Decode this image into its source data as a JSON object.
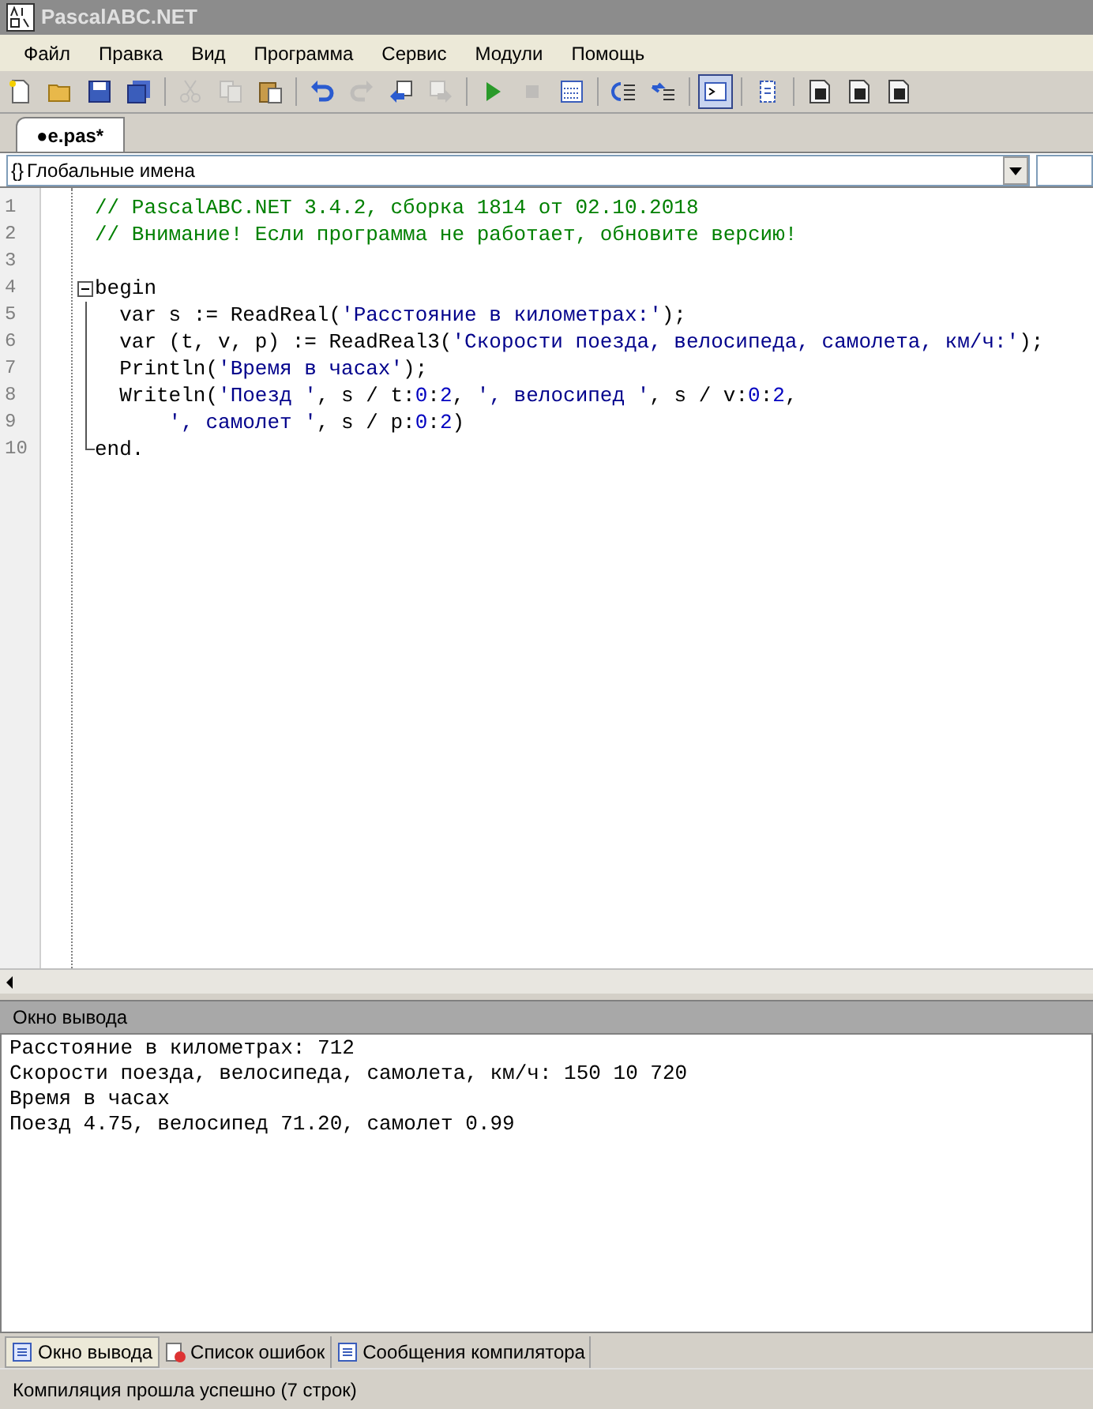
{
  "window": {
    "title": "PascalABC.NET"
  },
  "menu": [
    "Файл",
    "Правка",
    "Вид",
    "Программа",
    "Сервис",
    "Модули",
    "Помощь"
  ],
  "toolbar": [
    {
      "kind": "new",
      "disabled": false,
      "selected": false
    },
    {
      "kind": "open",
      "disabled": false,
      "selected": false
    },
    {
      "kind": "save",
      "disabled": false,
      "selected": false
    },
    {
      "kind": "saveall",
      "disabled": false,
      "selected": false
    },
    {
      "kind": "sep"
    },
    {
      "kind": "cut",
      "disabled": true,
      "selected": false
    },
    {
      "kind": "copy",
      "disabled": true,
      "selected": false
    },
    {
      "kind": "paste",
      "disabled": false,
      "selected": false
    },
    {
      "kind": "sep"
    },
    {
      "kind": "undo",
      "disabled": false,
      "selected": false
    },
    {
      "kind": "redo",
      "disabled": true,
      "selected": false
    },
    {
      "kind": "back",
      "disabled": false,
      "selected": false
    },
    {
      "kind": "forward",
      "disabled": true,
      "selected": false
    },
    {
      "kind": "sep"
    },
    {
      "kind": "run",
      "disabled": false,
      "selected": false
    },
    {
      "kind": "stop",
      "disabled": true,
      "selected": false
    },
    {
      "kind": "compile",
      "disabled": false,
      "selected": false
    },
    {
      "kind": "sep"
    },
    {
      "kind": "stepin",
      "disabled": false,
      "selected": false
    },
    {
      "kind": "stepover",
      "disabled": false,
      "selected": false
    },
    {
      "kind": "sep"
    },
    {
      "kind": "console",
      "disabled": false,
      "selected": true
    },
    {
      "kind": "sep"
    },
    {
      "kind": "format",
      "disabled": false,
      "selected": false
    },
    {
      "kind": "sep"
    },
    {
      "kind": "doc",
      "disabled": false,
      "selected": false
    },
    {
      "kind": "doc",
      "disabled": false,
      "selected": false
    },
    {
      "kind": "doc",
      "disabled": false,
      "selected": false
    }
  ],
  "doc_tabs": [
    {
      "label": "●e.pas*",
      "selected": true
    }
  ],
  "scope_combo": {
    "icon": "{}",
    "value": "Глобальные имена"
  },
  "editor": {
    "lines": [
      {
        "number": "1",
        "tokens": [
          {
            "kind": "comment",
            "text": "// PascalABC.NET 3.4.2, сборка 1814 от 02.10.2018"
          }
        ]
      },
      {
        "number": "2",
        "tokens": [
          {
            "kind": "comment",
            "text": "// Внимание! Если программа не работает, обновите версию!"
          }
        ]
      },
      {
        "number": "3"
      },
      {
        "number": "4",
        "kind": "fold_start",
        "tokens": [
          {
            "kind": "plain",
            "text": "begin"
          }
        ]
      },
      {
        "number": "5",
        "kind": "fold_inner",
        "tokens": [
          {
            "kind": "plain",
            "text": "  var s := ReadReal("
          },
          {
            "kind": "string",
            "text": "'Расстояние в километрах:'"
          },
          {
            "kind": "plain",
            "text": ");"
          }
        ]
      },
      {
        "number": "6",
        "kind": "fold_inner",
        "tokens": [
          {
            "kind": "plain",
            "text": "  var (t, v, p) := ReadReal3("
          },
          {
            "kind": "string",
            "text": "'Скорости поезда, велосипеда, самолета, км/ч:'"
          },
          {
            "kind": "plain",
            "text": ");"
          }
        ]
      },
      {
        "number": "7",
        "kind": "fold_inner",
        "tokens": [
          {
            "kind": "plain",
            "text": "  Println("
          },
          {
            "kind": "string",
            "text": "'Время в часах'"
          },
          {
            "kind": "plain",
            "text": ");"
          }
        ]
      },
      {
        "number": "8",
        "kind": "fold_inner",
        "tokens": [
          {
            "kind": "plain",
            "text": "  Writeln("
          },
          {
            "kind": "string",
            "text": "'Поезд '"
          },
          {
            "kind": "plain",
            "text": ", s / t:"
          },
          {
            "kind": "number",
            "text": "0"
          },
          {
            "kind": "plain",
            "text": ":"
          },
          {
            "kind": "number",
            "text": "2"
          },
          {
            "kind": "plain",
            "text": ", "
          },
          {
            "kind": "string",
            "text": "', велосипед '"
          },
          {
            "kind": "plain",
            "text": ", s / v:"
          },
          {
            "kind": "number",
            "text": "0"
          },
          {
            "kind": "plain",
            "text": ":"
          },
          {
            "kind": "number",
            "text": "2"
          },
          {
            "kind": "plain",
            "text": ","
          }
        ]
      },
      {
        "number": "9",
        "kind": "fold_inner",
        "tokens": [
          {
            "kind": "string",
            "text": "      ', самолет '"
          },
          {
            "kind": "plain",
            "text": ", s / p:"
          },
          {
            "kind": "number",
            "text": "0"
          },
          {
            "kind": "plain",
            "text": ":"
          },
          {
            "kind": "number",
            "text": "2"
          },
          {
            "kind": "plain",
            "text": ")"
          }
        ]
      },
      {
        "number": "10",
        "kind": "fold_end",
        "tokens": [
          {
            "kind": "plain",
            "text": "end."
          }
        ]
      }
    ]
  },
  "output": {
    "title": "Окно вывода",
    "lines": [
      "Расстояние в километрах: 712",
      "Скорости поезда, велосипеда, самолета, км/ч: 150 10 720",
      "Время в часах",
      "Поезд 4.75, велосипед 71.20, самолет 0.99"
    ]
  },
  "bottom_tabs": [
    {
      "kind": "output",
      "label": "Окно вывода",
      "selected": true
    },
    {
      "kind": "errors",
      "label": "Список ошибок",
      "selected": false
    },
    {
      "kind": "messages",
      "label": "Сообщения компилятора",
      "selected": false
    }
  ],
  "status_bar": "Компиляция прошла успешно (7 строк)"
}
